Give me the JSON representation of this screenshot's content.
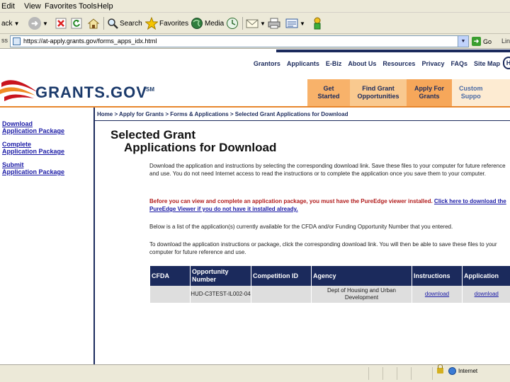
{
  "browser": {
    "menu": [
      "Edit",
      "View",
      "Favorites",
      "Tools",
      "Help"
    ],
    "toolbar": {
      "back_label": "ack",
      "search_label": "Search",
      "favorites_label": "Favorites",
      "media_label": "Media"
    },
    "address": {
      "label": "ss",
      "url": "https://at-apply.grants.gov/forms_apps_idx.html",
      "go_label": "Go",
      "links_label": "Lin"
    },
    "status": {
      "zone": "Internet"
    }
  },
  "site": {
    "top_nav": [
      "Grantors",
      "Applicants",
      "E-Biz",
      "About Us",
      "Resources",
      "Privacy",
      "FAQs",
      "Site Map"
    ],
    "help_badge": "H",
    "logo": "GRANTS.GOV",
    "logo_mark": "SM",
    "tabs": [
      {
        "line1": "Get",
        "line2": "Started"
      },
      {
        "line1": "Find Grant",
        "line2": "Opportunities"
      },
      {
        "line1": "Apply For",
        "line2": "Grants"
      },
      {
        "line1": "Custom",
        "line2": "Suppo"
      }
    ],
    "left_nav": [
      {
        "line1": "Download",
        "line2": "Application Package"
      },
      {
        "line1": "Complete",
        "line2": "Application Package"
      },
      {
        "line1": "Submit",
        "line2": "Application Package"
      }
    ],
    "breadcrumb": "Home > Apply for Grants > Forms & Applications > Selected Grant Applications for Download",
    "title_line1": "Selected Grant",
    "title_line2": "Applications for Download",
    "para1": "Download the application and instructions by selecting the corresponding download link. Save these files to your computer for future reference and use. You do not need Internet access to read the instructions or to complete the application once you save them to your computer.",
    "para2_red": "Before you can view and complete an application package, you must have the PureEdge viewer installed.",
    "para2_link": "Click here to download the PureEdge Viewer if you do not have it installed already.",
    "para3": "Below is a list of the application(s) currently available for the CFDA and/or Funding Opportunity Number that you entered.",
    "para4": "To download the application instructions or package, click the corresponding download link. You will then be able to save these files to your computer for future reference and use.",
    "table": {
      "headers": [
        "CFDA",
        "Opportunity Number",
        "Competition ID",
        "Agency",
        "Instructions",
        "Application"
      ],
      "row": {
        "cfda": "",
        "opportunity": "HUD-C3TEST-IL002-04",
        "competition": "",
        "agency": "Dept of Housing and Urban Development",
        "instructions": "download",
        "application": "download"
      }
    }
  },
  "colors": {
    "navy": "#1b2a5c",
    "orange": "#e7862c",
    "link": "#1a1aa6",
    "warning_red": "#b11a1a"
  }
}
